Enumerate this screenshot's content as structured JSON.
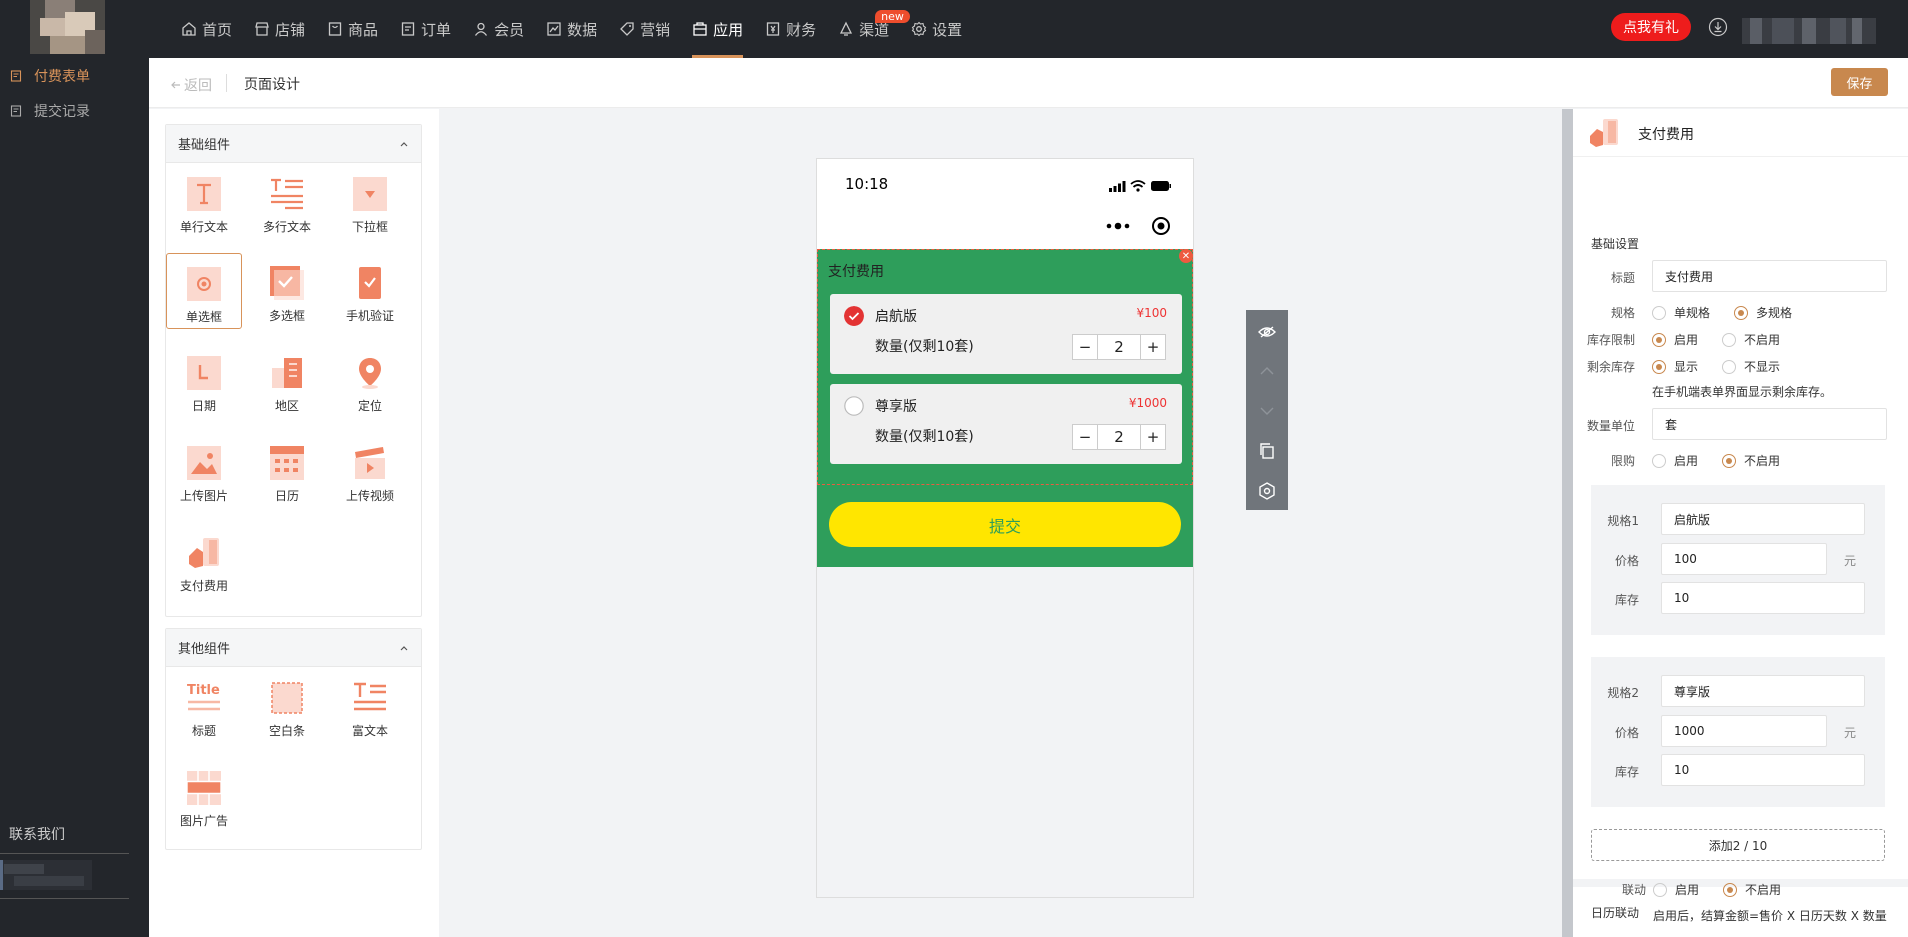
{
  "nav": {
    "items": [
      {
        "label": "首页",
        "icon": "home-icon"
      },
      {
        "label": "店铺",
        "icon": "store-icon"
      },
      {
        "label": "商品",
        "icon": "goods-icon"
      },
      {
        "label": "订单",
        "icon": "order-icon"
      },
      {
        "label": "会员",
        "icon": "member-icon"
      },
      {
        "label": "数据",
        "icon": "chart-icon"
      },
      {
        "label": "营销",
        "icon": "tag-icon"
      },
      {
        "label": "应用",
        "icon": "app-icon",
        "active": true
      },
      {
        "label": "财务",
        "icon": "finance-icon"
      },
      {
        "label": "渠道",
        "icon": "channel-icon",
        "badge": "new"
      },
      {
        "label": "设置",
        "icon": "gear-icon"
      }
    ],
    "gift_button": "点我有礼"
  },
  "sidebar": {
    "items": [
      {
        "label": "付费表单",
        "active": true
      },
      {
        "label": "提交记录"
      }
    ],
    "contact": "联系我们"
  },
  "header": {
    "back": "返回",
    "title": "页面设计",
    "save": "保存"
  },
  "palette": {
    "basic_title": "基础组件",
    "basic": [
      "单行文本",
      "多行文本",
      "下拉框",
      "单选框",
      "多选框",
      "手机验证",
      "日期",
      "地区",
      "定位",
      "上传图片",
      "日历",
      "上传视频",
      "支付费用"
    ],
    "other_title": "其他组件",
    "other": [
      "标题",
      "空白条",
      "富文本",
      "图片广告"
    ],
    "other_title_icon_text": "Title"
  },
  "phone": {
    "time": "10:18",
    "block_title": "支付费用",
    "cards": [
      {
        "name": "启航版",
        "price": "¥100",
        "qty_label": "数量(仅剩10套)",
        "qty": "2",
        "checked": true
      },
      {
        "name": "尊享版",
        "price": "¥1000",
        "qty_label": "数量(仅剩10套)",
        "qty": "2",
        "checked": false
      }
    ],
    "submit": "提交",
    "colors": {
      "background": "#2e9e5b",
      "button": "#ffe600",
      "button_text": "#2e9e5b",
      "price": "#e33333"
    }
  },
  "props": {
    "title": "支付费用",
    "basic_section": "基础设置",
    "title_label": "标题",
    "title_value": "支付费用",
    "spec_label": "规格",
    "spec_options": [
      "单规格",
      "多规格"
    ],
    "stock_limit_label": "库存限制",
    "stock_limit_options": [
      "启用",
      "不启用"
    ],
    "remaining_label": "剩余库存",
    "remaining_options": [
      "显示",
      "不显示"
    ],
    "remaining_note": "在手机端表单界面显示剩余库存。",
    "unit_label": "数量单位",
    "unit_value": "套",
    "limit_label": "限购",
    "limit_options": [
      "启用",
      "不启用"
    ],
    "specs": [
      {
        "spec_label": "规格1",
        "name": "启航版",
        "price_label": "价格",
        "price": "100",
        "currency": "元",
        "stock_label": "库存",
        "stock": "10"
      },
      {
        "spec_label": "规格2",
        "name": "尊享版",
        "price_label": "价格",
        "price": "1000",
        "currency": "元",
        "stock_label": "库存",
        "stock": "10"
      }
    ],
    "add_button": "添加2 / 10",
    "calendar_section": "日历联动",
    "link_label": "联动",
    "link_options": [
      "启用",
      "不启用"
    ],
    "link_note": "启用后，结算金额=售价 X 日历天数 X 数量"
  }
}
